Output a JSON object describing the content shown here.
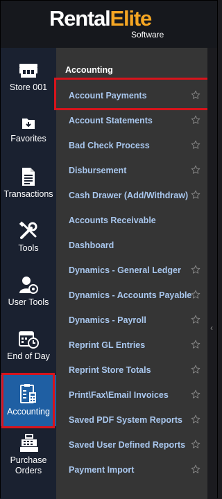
{
  "brand": {
    "name_part1": "Rental",
    "name_part2": "Elite",
    "subtitle": "Software",
    "accent_color": "#f5a623"
  },
  "rail": {
    "items": [
      {
        "label": "Store 001",
        "icon": "store-icon"
      },
      {
        "label": "Favorites",
        "icon": "favorites-folder-icon"
      },
      {
        "label": "Transactions",
        "icon": "document-icon"
      },
      {
        "label": "Tools",
        "icon": "tools-icon"
      },
      {
        "label": "User Tools",
        "icon": "user-tools-icon"
      },
      {
        "label": "End of Day",
        "icon": "calendar-clock-icon"
      },
      {
        "label": "Accounting",
        "icon": "accounting-clipboard-icon"
      },
      {
        "label": "Purchase Orders",
        "label_line1": "Purchase",
        "label_line2": "Orders",
        "icon": "cash-register-icon"
      }
    ],
    "active": "Accounting",
    "active_color": "#1f5fa3"
  },
  "panel": {
    "title": "Accounting",
    "items": [
      {
        "label": "Account Payments",
        "star": true
      },
      {
        "label": "Account Statements",
        "star": true
      },
      {
        "label": "Bad Check Process",
        "star": true
      },
      {
        "label": "Disbursement",
        "star": true
      },
      {
        "label": "Cash Drawer (Add/Withdraw)",
        "star": true
      },
      {
        "label": "Accounts Receivable",
        "star": false
      },
      {
        "label": "Dashboard",
        "star": false
      },
      {
        "label": "Dynamics - General Ledger",
        "star": true
      },
      {
        "label": "Dynamics - Accounts Payable",
        "star": true
      },
      {
        "label": "Dynamics - Payroll",
        "star": true
      },
      {
        "label": "Reprint GL Entries",
        "star": true
      },
      {
        "label": "Reprint Store Totals",
        "star": true
      },
      {
        "label": "Print\\Fax\\Email Invoices",
        "star": true
      },
      {
        "label": "Saved PDF System Reports",
        "star": true
      },
      {
        "label": "Saved User Defined Reports",
        "star": true
      },
      {
        "label": "Payment Import",
        "star": true
      }
    ],
    "highlighted": "Account Payments",
    "highlight_color": "#d7141c"
  },
  "collapse": {
    "icon": "chevron-left-icon"
  }
}
